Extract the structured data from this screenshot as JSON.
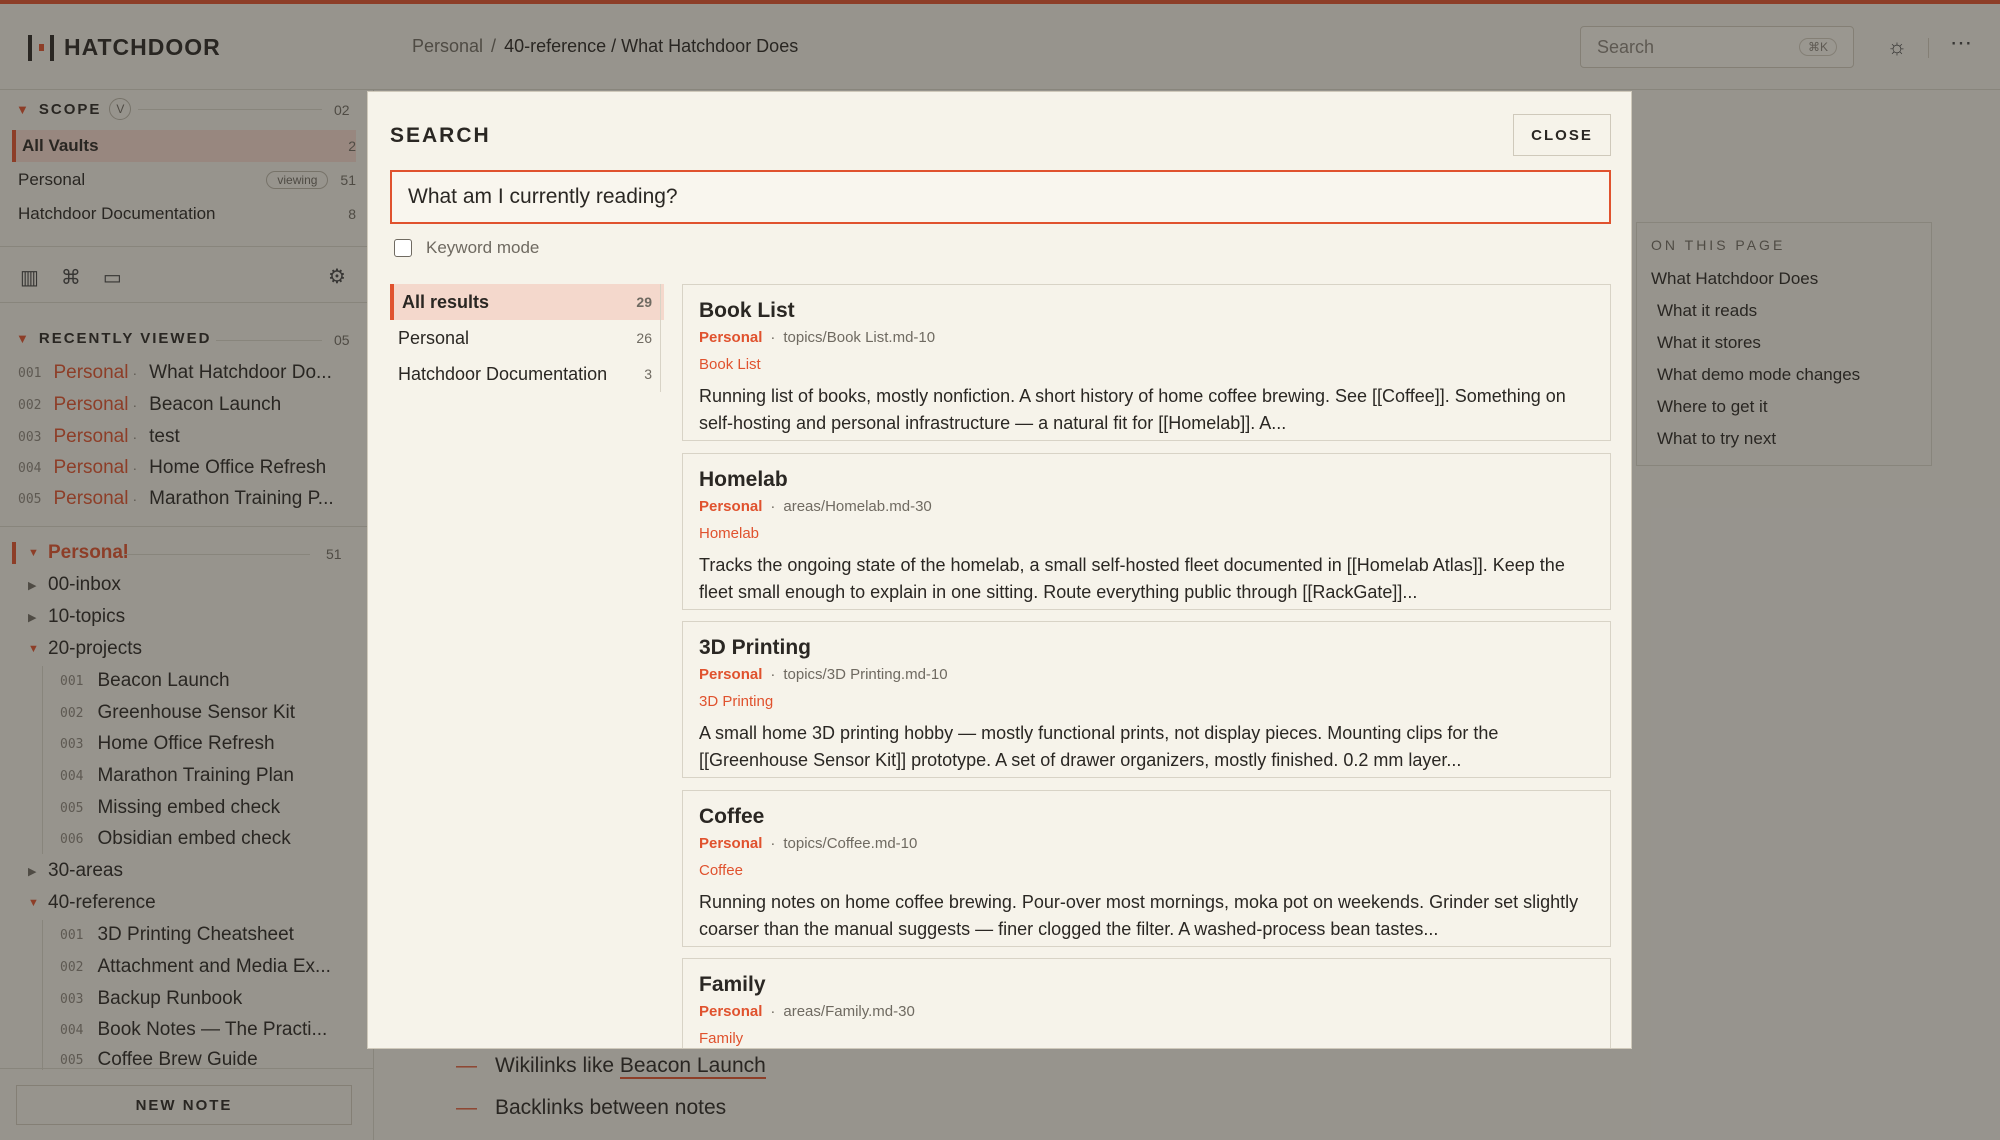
{
  "app": {
    "name": "HATCHDOOR"
  },
  "breadcrumb": {
    "root": "Personal",
    "sep": "/",
    "current": "40-reference / What Hatchdoor Does"
  },
  "topbar": {
    "search_placeholder": "Search",
    "shortcut": "⌘K"
  },
  "icons": {
    "sun": "sun-icon",
    "more": "more-horizontal-icon",
    "stats": "bar-chart-icon",
    "graph": "graph-icon",
    "inbox": "inbox-icon",
    "gear": "gear-icon"
  },
  "colors": {
    "accent": "#e0522e",
    "background": "#f2efe6"
  },
  "sidebar": {
    "scope": {
      "title": "SCOPE",
      "key": "V",
      "count": "02",
      "items": [
        {
          "label": "All Vaults",
          "count": "2"
        },
        {
          "label": "Personal",
          "badge": "viewing",
          "count": "51"
        },
        {
          "label": "Hatchdoor Documentation",
          "count": "8"
        }
      ]
    },
    "recent": {
      "title": "RECENTLY VIEWED",
      "count": "05",
      "items": [
        {
          "idx": "001",
          "vault": "Personal",
          "title": "What Hatchdoor Do..."
        },
        {
          "idx": "002",
          "vault": "Personal",
          "title": "Beacon Launch"
        },
        {
          "idx": "003",
          "vault": "Personal",
          "title": "test"
        },
        {
          "idx": "004",
          "vault": "Personal",
          "title": "Home Office Refresh"
        },
        {
          "idx": "005",
          "vault": "Personal",
          "title": "Marathon Training P..."
        }
      ]
    },
    "vault": {
      "name": "Personal",
      "count": "51",
      "folders": {
        "inbox": "00-inbox",
        "topics": "10-topics",
        "projects": "20-projects",
        "areas": "30-areas",
        "reference": "40-reference"
      },
      "projects": [
        {
          "idx": "001",
          "title": "Beacon Launch"
        },
        {
          "idx": "002",
          "title": "Greenhouse Sensor Kit"
        },
        {
          "idx": "003",
          "title": "Home Office Refresh"
        },
        {
          "idx": "004",
          "title": "Marathon Training Plan"
        },
        {
          "idx": "005",
          "title": "Missing embed check"
        },
        {
          "idx": "006",
          "title": "Obsidian embed check"
        }
      ],
      "reference": [
        {
          "idx": "001",
          "title": "3D Printing Cheatsheet"
        },
        {
          "idx": "002",
          "title": "Attachment and Media Ex..."
        },
        {
          "idx": "003",
          "title": "Backup Runbook"
        },
        {
          "idx": "004",
          "title": "Book Notes — The Practi..."
        },
        {
          "idx": "005",
          "title": "Coffee Brew Guide"
        }
      ]
    },
    "new_note": "NEW NOTE"
  },
  "toc": {
    "title": "ON THIS PAGE",
    "items": [
      "What Hatchdoor Does",
      "What it reads",
      "What it stores",
      "What demo mode changes",
      "Where to get it",
      "What to try next"
    ]
  },
  "content": {
    "bullet1_prefix": "Wikilinks like ",
    "bullet1_link": "Beacon Launch",
    "bullet2": "Backlinks between notes",
    "dash": "—"
  },
  "search": {
    "title": "SEARCH",
    "close": "CLOSE",
    "query": "What am I currently reading?",
    "keyword_mode": "Keyword mode",
    "facets": [
      {
        "label": "All results",
        "count": "29"
      },
      {
        "label": "Personal",
        "count": "26"
      },
      {
        "label": "Hatchdoor Documentation",
        "count": "3"
      }
    ],
    "results": [
      {
        "title": "Book List",
        "vault": "Personal",
        "path": "topics/Book List.md-10",
        "tag": "Book List",
        "excerpt": "Running list of books, mostly nonfiction. A short history of home coffee brewing. See [[Coffee]]. Something on self-hosting and personal infrastructure — a natural fit for [[Homelab]]. A..."
      },
      {
        "title": "Homelab",
        "vault": "Personal",
        "path": "areas/Homelab.md-30",
        "tag": "Homelab",
        "excerpt": "Tracks the ongoing state of the homelab, a small self-hosted fleet documented in [[Homelab Atlas]]. Keep the fleet small enough to explain in one sitting. Route everything public through [[RackGate]]..."
      },
      {
        "title": "3D Printing",
        "vault": "Personal",
        "path": "topics/3D Printing.md-10",
        "tag": "3D Printing",
        "excerpt": "A small home 3D printing hobby — mostly functional prints, not display pieces. Mounting clips for the [[Greenhouse Sensor Kit]] prototype. A set of drawer organizers, mostly finished. 0.2 mm layer..."
      },
      {
        "title": "Coffee",
        "vault": "Personal",
        "path": "topics/Coffee.md-10",
        "tag": "Coffee",
        "excerpt": "Running notes on home coffee brewing. Pour-over most mornings, moka pot on weekends. Grinder set slightly coarser than the manual suggests — finer clogged the filter. A washed-process bean tastes..."
      },
      {
        "title": "Family",
        "vault": "Personal",
        "path": "areas/Family.md-30",
        "tag": "Family",
        "excerpt": ""
      }
    ]
  }
}
